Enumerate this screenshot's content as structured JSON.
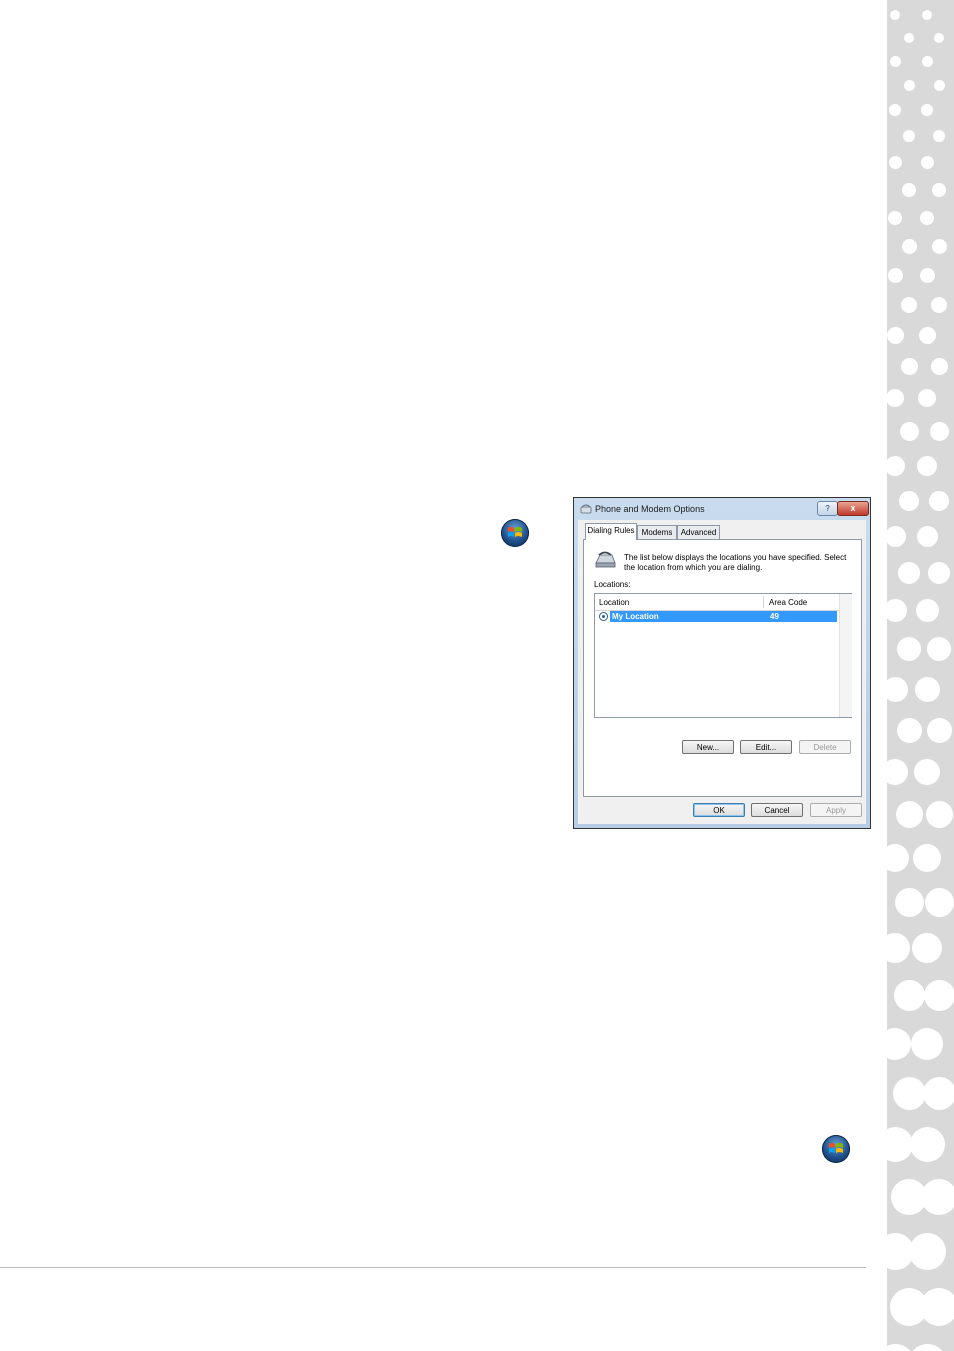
{
  "dialog": {
    "title": "Phone and Modem Options",
    "help_glyph": "?",
    "close_glyph": "x",
    "tabs": [
      {
        "label": "Dialing Rules",
        "active": true
      },
      {
        "label": "Modems",
        "active": false
      },
      {
        "label": "Advanced",
        "active": false
      }
    ],
    "info_text": "The list below displays the locations you have specified. Select the location from which you are dialing.",
    "locations_label": "Locations:",
    "columns": {
      "location": "Location",
      "area_code": "Area Code"
    },
    "rows": [
      {
        "location": "My Location",
        "area_code": "49",
        "selected": true
      }
    ],
    "buttons": {
      "new": "New...",
      "edit": "Edit...",
      "delete": "Delete"
    },
    "footer_buttons": {
      "ok": "OK",
      "cancel": "Cancel",
      "apply": "Apply"
    }
  },
  "icons": {
    "start_orb_1": "windows-start-orb-icon",
    "start_orb_2": "windows-start-orb-icon",
    "dialog_title": "phone-modem-icon",
    "info": "telephone-icon"
  },
  "colors": {
    "side_band": "#d9d9d9",
    "selection": "#3399ff",
    "close_button": "#c0392b"
  }
}
